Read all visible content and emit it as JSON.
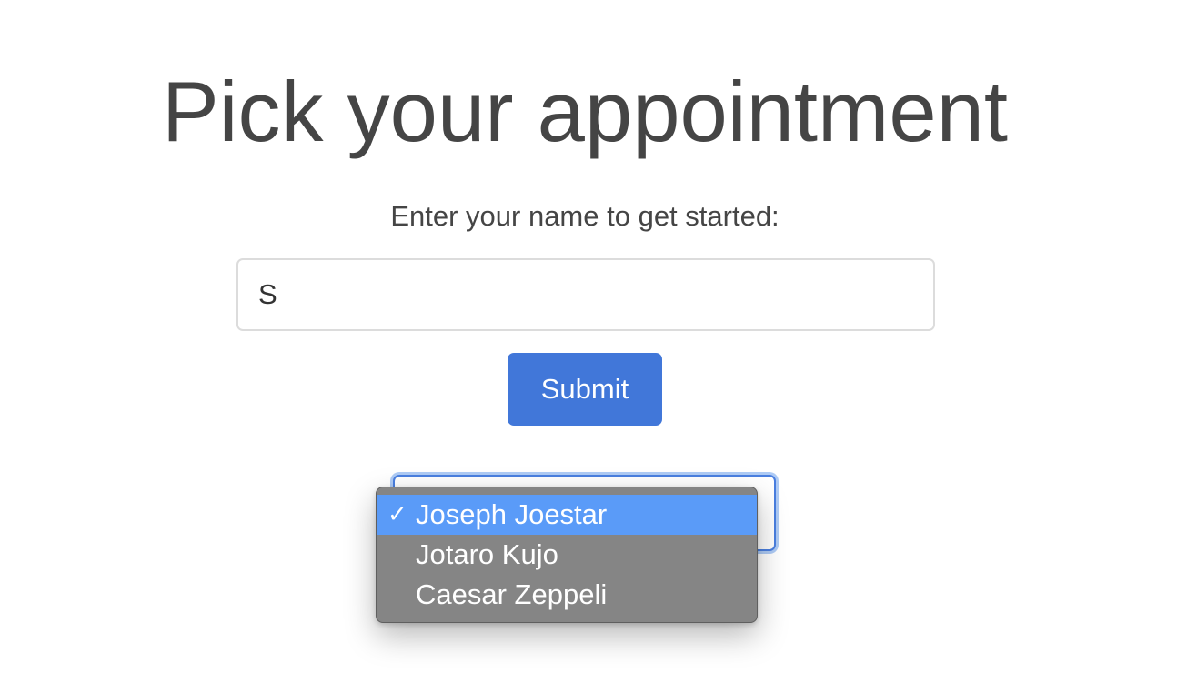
{
  "page": {
    "title": "Pick your appointment",
    "prompt": "Enter your name to get started:"
  },
  "form": {
    "name_value": "S",
    "submit_label": "Submit"
  },
  "select": {
    "selected_value": "Joseph Joestar",
    "check_glyph": "✓",
    "options": [
      {
        "label": "Joseph Joestar",
        "selected": true
      },
      {
        "label": "Jotaro Kujo",
        "selected": false
      },
      {
        "label": "Caesar Zeppeli",
        "selected": false
      }
    ]
  },
  "colors": {
    "button": "#4177d9",
    "highlight": "#5a9bf8",
    "dropdown_bg": "#858585",
    "focus_ring": "#aecbf5"
  }
}
